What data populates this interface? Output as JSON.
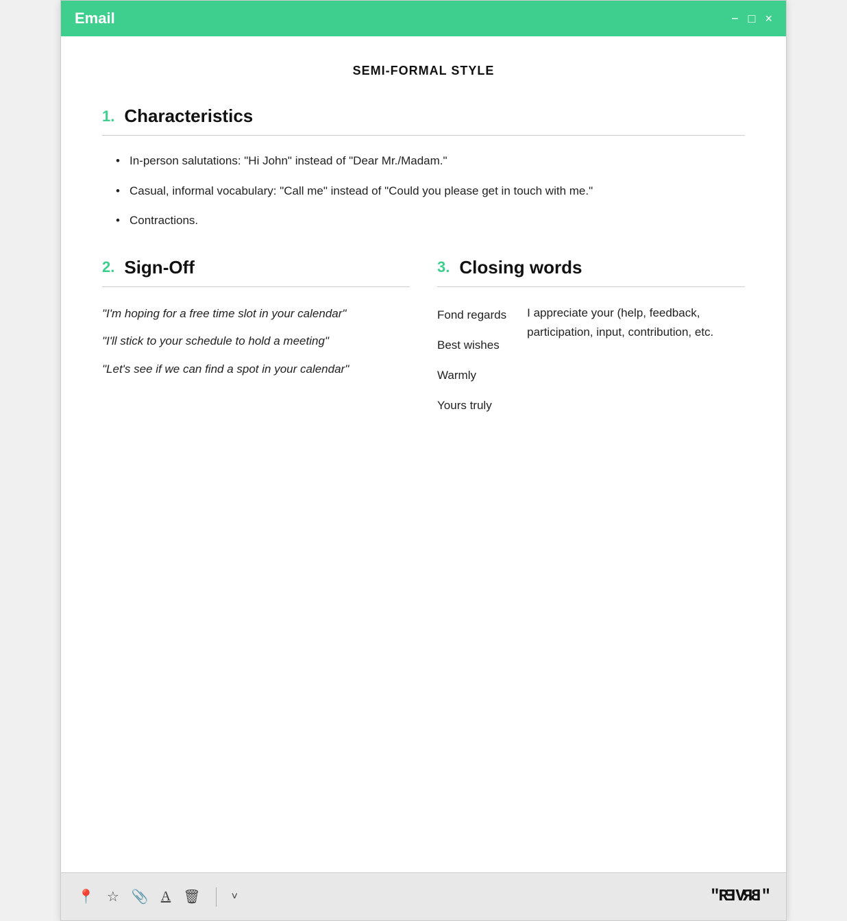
{
  "titlebar": {
    "title": "Email",
    "controls": [
      "−",
      "□",
      "×"
    ]
  },
  "main": {
    "title": "SEMI-FORMAL STYLE",
    "section1": {
      "number": "1.",
      "title": "Characteristics",
      "bullets": [
        "In-person salutations: \"Hi John\" instead of \"Dear Mr./Madam.\"",
        "Casual, informal vocabulary: \"Call me\" instead of \"Could you please get in touch with me.\"",
        "Contractions."
      ]
    },
    "section2": {
      "number": "2.",
      "title": "Sign-Off",
      "quotes": [
        "\"I'm hoping for a free time slot in your calendar\"",
        "\"I'll stick to your schedule to hold a meeting\"",
        "\"Let's see if we can find a spot in your calendar\""
      ]
    },
    "section3": {
      "number": "3.",
      "title": "Closing words",
      "words_left": [
        "Fond regards",
        "Best wishes",
        "Warmly",
        "Yours truly"
      ],
      "words_right": "I appreciate your (help, feedback, participation, input, contribution, etc."
    }
  },
  "footer": {
    "icons": [
      "📍",
      "☆",
      "📎",
      "A",
      "🗑"
    ],
    "dropdown": "˅",
    "logo": "\"REVERB\""
  }
}
